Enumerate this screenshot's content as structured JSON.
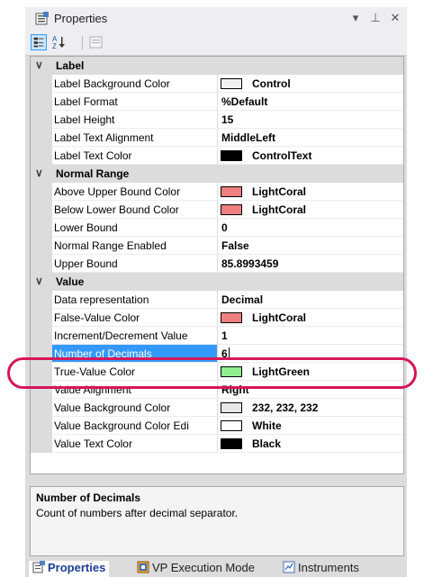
{
  "window": {
    "title": "Properties",
    "dropdown_icon": "▾",
    "pin_icon": "⊥",
    "close_icon": "✕"
  },
  "categories": [
    {
      "label": "Label",
      "toggle": "∨",
      "properties": [
        {
          "name": "Label Background Color",
          "value": "Control",
          "swatch": "#f0f0f0"
        },
        {
          "name": "Label Format",
          "value": "%Default"
        },
        {
          "name": "Label Height",
          "value": "15"
        },
        {
          "name": "Label Text Alignment",
          "value": "MiddleLeft"
        },
        {
          "name": "Label Text Color",
          "value": "ControlText",
          "swatch": "#000000"
        }
      ]
    },
    {
      "label": "Normal Range",
      "toggle": "∨",
      "properties": [
        {
          "name": "Above Upper Bound Color",
          "value": "LightCoral",
          "swatch": "#f08080"
        },
        {
          "name": "Below Lower Bound Color",
          "value": "LightCoral",
          "swatch": "#f08080"
        },
        {
          "name": "Lower Bound",
          "value": "0"
        },
        {
          "name": "Normal Range Enabled",
          "value": "False"
        },
        {
          "name": "Upper Bound",
          "value": "85.8993459"
        }
      ]
    },
    {
      "label": "Value",
      "toggle": "∨",
      "properties": [
        {
          "name": "Data representation",
          "value": "Decimal"
        },
        {
          "name": "False-Value Color",
          "value": "LightCoral",
          "swatch": "#f08080"
        },
        {
          "name": "Increment/Decrement Value",
          "value": "1"
        },
        {
          "name": "Number of Decimals",
          "value": "6",
          "selected": true
        },
        {
          "name": "True-Value Color",
          "value": "LightGreen",
          "swatch": "#90ee90"
        },
        {
          "name": "Value Alignment",
          "value": "Right"
        },
        {
          "name": "Value Background Color",
          "value": "232, 232, 232",
          "swatch": "#e8e8e8"
        },
        {
          "name": "Value Background Color Edi",
          "value": "White",
          "swatch": "#ffffff"
        },
        {
          "name": "Value Text Color",
          "value": "Black",
          "swatch": "#000000"
        }
      ]
    }
  ],
  "description": {
    "title": "Number of Decimals",
    "text": "Count of numbers after decimal separator."
  },
  "tabs": [
    {
      "label": "Properties",
      "icon": "properties-icon",
      "active": true
    },
    {
      "label": "VP Execution Mode",
      "icon": "execution-mode-icon",
      "active": false
    },
    {
      "label": "Instruments",
      "icon": "instruments-icon",
      "active": false
    }
  ],
  "colors": {
    "selection": "#3399ff",
    "highlight_ring": "#d6165a"
  }
}
